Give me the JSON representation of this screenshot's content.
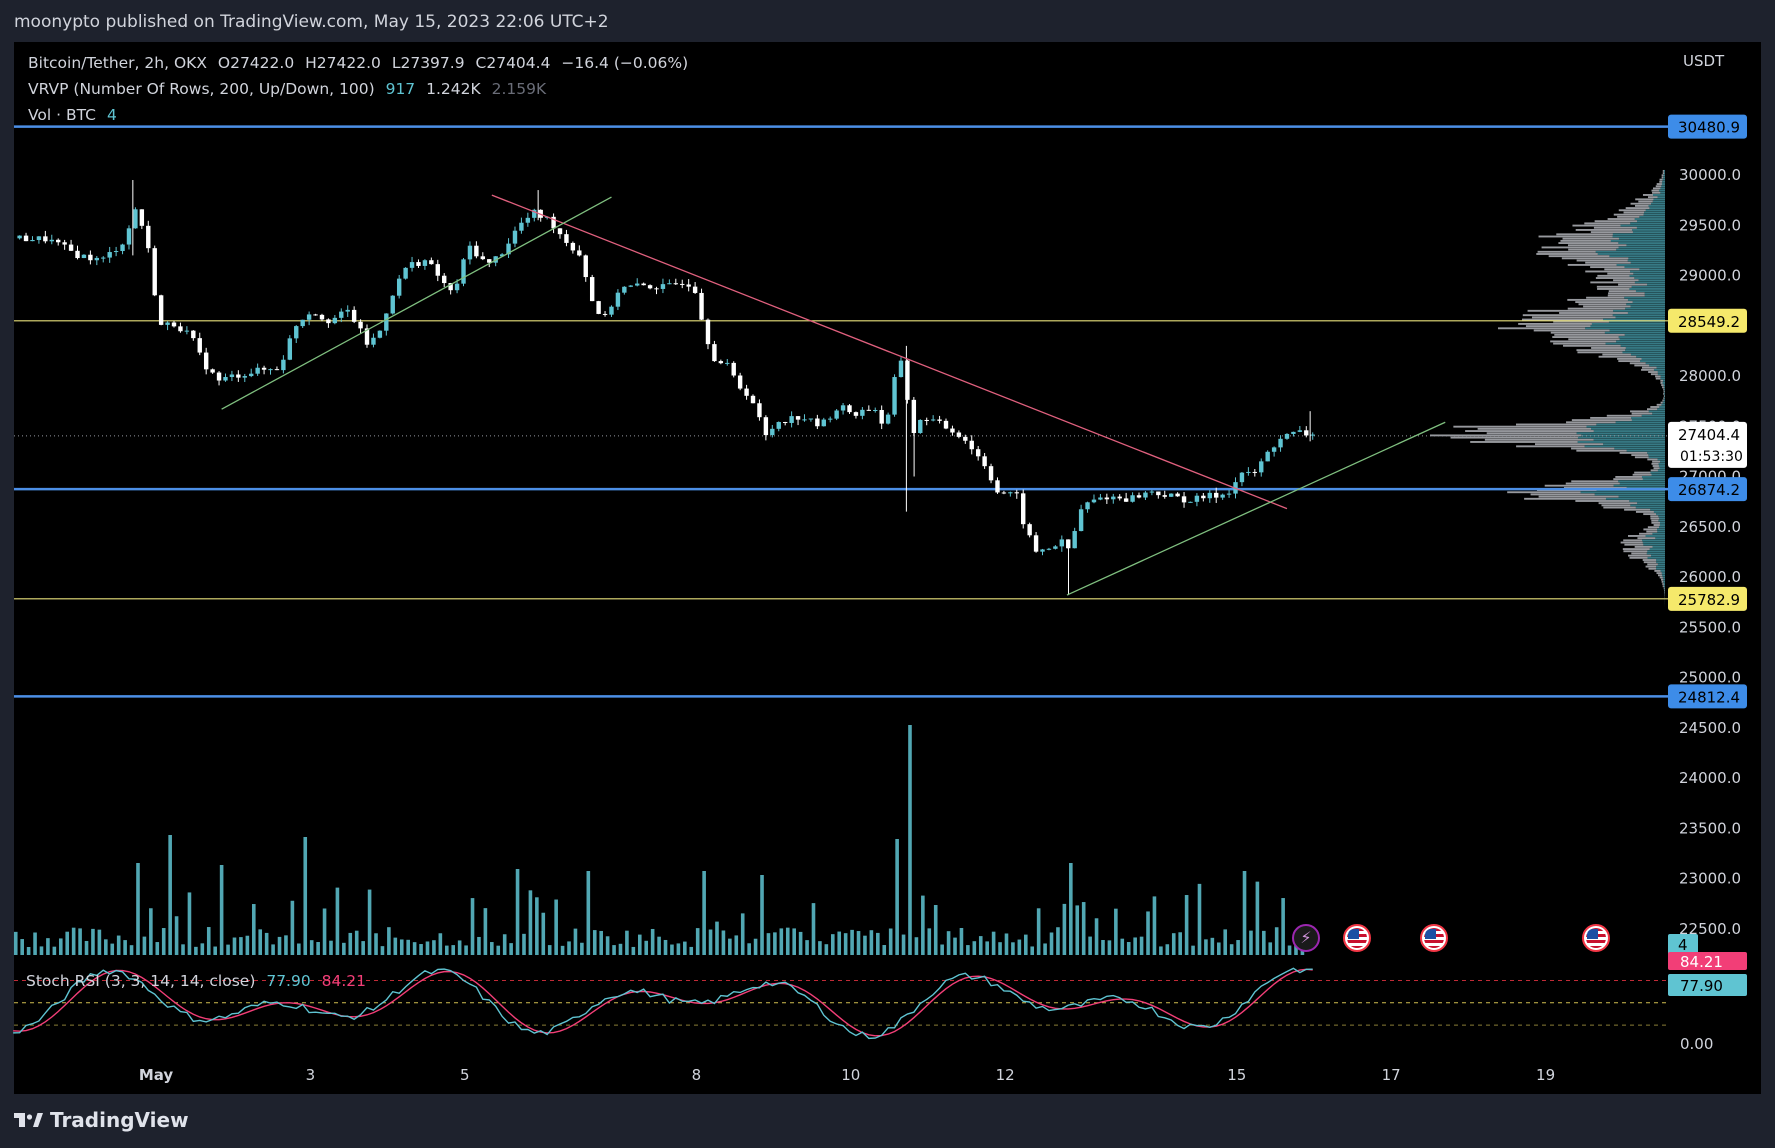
{
  "header": {
    "publish_text": "moonypto published on TradingView.com, May 15, 2023 22:06 UTC+2"
  },
  "legend": {
    "symbol": "Bitcoin/Tether, 2h, OKX",
    "o_label": "O",
    "o_value": "27422.0",
    "h_label": "H",
    "h_value": "27422.0",
    "l_label": "L",
    "l_value": "27397.9",
    "c_label": "C",
    "c_value": "27404.4",
    "change": "−16.4 (−0.06%)",
    "vrvp_label": "VRVP (Number Of Rows, 200, Up/Down, 100)",
    "vrvp_v1": "917",
    "vrvp_v2": "1.242K",
    "vrvp_v3": "2.159K",
    "vol_label": "Vol · BTC",
    "vol_value": "4",
    "stoch_label": "Stoch RSI (3, 3, 14, 14, close)",
    "stoch_k": "77.90",
    "stoch_d": "84.21"
  },
  "currency": "USDT",
  "footer": {
    "brand": "TradingView"
  },
  "colors": {
    "up": "#5fc4d2",
    "down": "#ffffff",
    "blue_level": "#4c8fe6",
    "yellow_level": "#e8e07a",
    "trend_red": "#e0607e",
    "trend_green": "#7fbf7f",
    "stoch_k": "#5fc4d2",
    "stoch_d": "#f23e77"
  },
  "chart_data": {
    "type": "candlestick",
    "symbol": "Bitcoin/Tether",
    "interval": "2h",
    "y_axis": {
      "ylim": [
        24300,
        30650
      ],
      "ticks": [
        22500,
        23000,
        23500,
        24000,
        24500,
        25000,
        25500,
        26000,
        26500,
        27000,
        27500,
        28000,
        28500,
        29000,
        29500,
        30000
      ],
      "tick_labels": [
        "22500.0",
        "23000.0",
        "23500.0",
        "24000.0",
        "24500.0",
        "25000.0",
        "25500.0",
        "26000.0",
        "26500.0",
        "27000.0",
        "27500.0",
        "28000.0",
        "28500.0",
        "29000.0",
        "29500.0",
        "30000.0"
      ]
    },
    "x_axis": {
      "tick_labels": [
        "May",
        "3",
        "5",
        "8",
        "10",
        "12",
        "15",
        "17",
        "19"
      ],
      "tick_day": [
        1,
        3,
        5,
        8,
        10,
        12,
        15,
        17,
        19
      ]
    },
    "horizontal_levels": [
      {
        "price": 30480.9,
        "label": "30480.9",
        "style": "blue"
      },
      {
        "price": 28549.2,
        "label": "28549.2",
        "style": "yellow"
      },
      {
        "price": 26874.2,
        "label": "26874.2",
        "style": "blue"
      },
      {
        "price": 25782.9,
        "label": "25782.9",
        "style": "yellow"
      },
      {
        "price": 24812.4,
        "label": "24812.4",
        "style": "blue"
      }
    ],
    "last_price": {
      "value": "27404.4",
      "countdown": "01:53:30"
    },
    "trendlines": [
      {
        "color": "red",
        "from": {
          "day": 5.35,
          "price": 29800
        },
        "to": {
          "day": 15.65,
          "price": 26680
        }
      },
      {
        "color": "green",
        "from": {
          "day": 1.85,
          "price": 27670
        },
        "to": {
          "day": 6.9,
          "price": 29780
        }
      },
      {
        "color": "green",
        "from": {
          "day": 12.8,
          "price": 25820
        },
        "to": {
          "day": 17.7,
          "price": 27540
        }
      }
    ],
    "price_path": [
      [
        -0.85,
        29370
      ],
      [
        -0.4,
        29360
      ],
      [
        0.0,
        29200
      ],
      [
        0.3,
        29150
      ],
      [
        0.6,
        29350
      ],
      [
        0.75,
        29700
      ],
      [
        0.9,
        29250
      ],
      [
        1.05,
        28500
      ],
      [
        1.25,
        28520
      ],
      [
        1.45,
        28400
      ],
      [
        1.6,
        28150
      ],
      [
        1.8,
        27950
      ],
      [
        2.0,
        28000
      ],
      [
        2.3,
        28050
      ],
      [
        2.6,
        28080
      ],
      [
        2.8,
        28500
      ],
      [
        3.0,
        28650
      ],
      [
        3.25,
        28550
      ],
      [
        3.5,
        28650
      ],
      [
        3.75,
        28300
      ],
      [
        3.9,
        28450
      ],
      [
        4.05,
        28800
      ],
      [
        4.25,
        29100
      ],
      [
        4.5,
        29150
      ],
      [
        4.7,
        28950
      ],
      [
        4.85,
        28800
      ],
      [
        5.05,
        29300
      ],
      [
        5.3,
        29100
      ],
      [
        5.5,
        29250
      ],
      [
        5.7,
        29500
      ],
      [
        5.9,
        29620
      ],
      [
        6.1,
        29550
      ],
      [
        6.3,
        29350
      ],
      [
        6.5,
        29200
      ],
      [
        6.65,
        28750
      ],
      [
        6.8,
        28550
      ],
      [
        7.0,
        28870
      ],
      [
        7.3,
        28900
      ],
      [
        7.6,
        28880
      ],
      [
        7.85,
        28950
      ],
      [
        8.0,
        28850
      ],
      [
        8.1,
        28450
      ],
      [
        8.25,
        28150
      ],
      [
        8.4,
        28100
      ],
      [
        8.55,
        27900
      ],
      [
        8.7,
        27800
      ],
      [
        8.9,
        27400
      ],
      [
        9.05,
        27550
      ],
      [
        9.35,
        27600
      ],
      [
        9.6,
        27500
      ],
      [
        9.85,
        27700
      ],
      [
        10.05,
        27620
      ],
      [
        10.3,
        27700
      ],
      [
        10.45,
        27450
      ],
      [
        10.6,
        28100
      ],
      [
        10.68,
        28200
      ],
      [
        10.78,
        27400
      ],
      [
        10.95,
        27600
      ],
      [
        11.2,
        27500
      ],
      [
        11.45,
        27400
      ],
      [
        11.6,
        27250
      ],
      [
        11.75,
        27100
      ],
      [
        11.9,
        26850
      ],
      [
        12.15,
        26800
      ],
      [
        12.25,
        26500
      ],
      [
        12.4,
        26250
      ],
      [
        12.6,
        26300
      ],
      [
        12.75,
        26350
      ],
      [
        12.85,
        26250
      ],
      [
        12.95,
        26650
      ],
      [
        13.1,
        26750
      ],
      [
        13.3,
        26800
      ],
      [
        13.6,
        26780
      ],
      [
        13.9,
        26850
      ],
      [
        14.15,
        26800
      ],
      [
        14.4,
        26760
      ],
      [
        14.6,
        26800
      ],
      [
        14.8,
        26820
      ],
      [
        14.95,
        26880
      ],
      [
        15.05,
        27050
      ],
      [
        15.2,
        27000
      ],
      [
        15.35,
        27180
      ],
      [
        15.55,
        27380
      ],
      [
        15.8,
        27440
      ],
      [
        16.0,
        27404.4
      ]
    ],
    "volume": {
      "name": "Vol · BTC",
      "last": 4,
      "spikes": [
        {
          "day": 0.72,
          "value": 46
        },
        {
          "day": 1.2,
          "value": 60
        },
        {
          "day": 1.85,
          "value": 45
        },
        {
          "day": 2.95,
          "value": 59
        },
        {
          "day": 5.7,
          "value": 43
        },
        {
          "day": 6.6,
          "value": 42
        },
        {
          "day": 8.05,
          "value": 42
        },
        {
          "day": 8.8,
          "value": 40
        },
        {
          "day": 10.58,
          "value": 58
        },
        {
          "day": 10.72,
          "value": 115
        },
        {
          "day": 12.8,
          "value": 46
        },
        {
          "day": 15.05,
          "value": 42
        }
      ]
    },
    "stoch_rsi": {
      "params": "Stoch RSI (3, 3, 14, 14, close)",
      "k": 77.9,
      "d": 84.21,
      "bands": [
        80,
        50,
        20
      ],
      "tick_labels": [
        "0.00"
      ]
    },
    "vrvp": {
      "rows": 200,
      "poc_price": 27404.4
    }
  }
}
